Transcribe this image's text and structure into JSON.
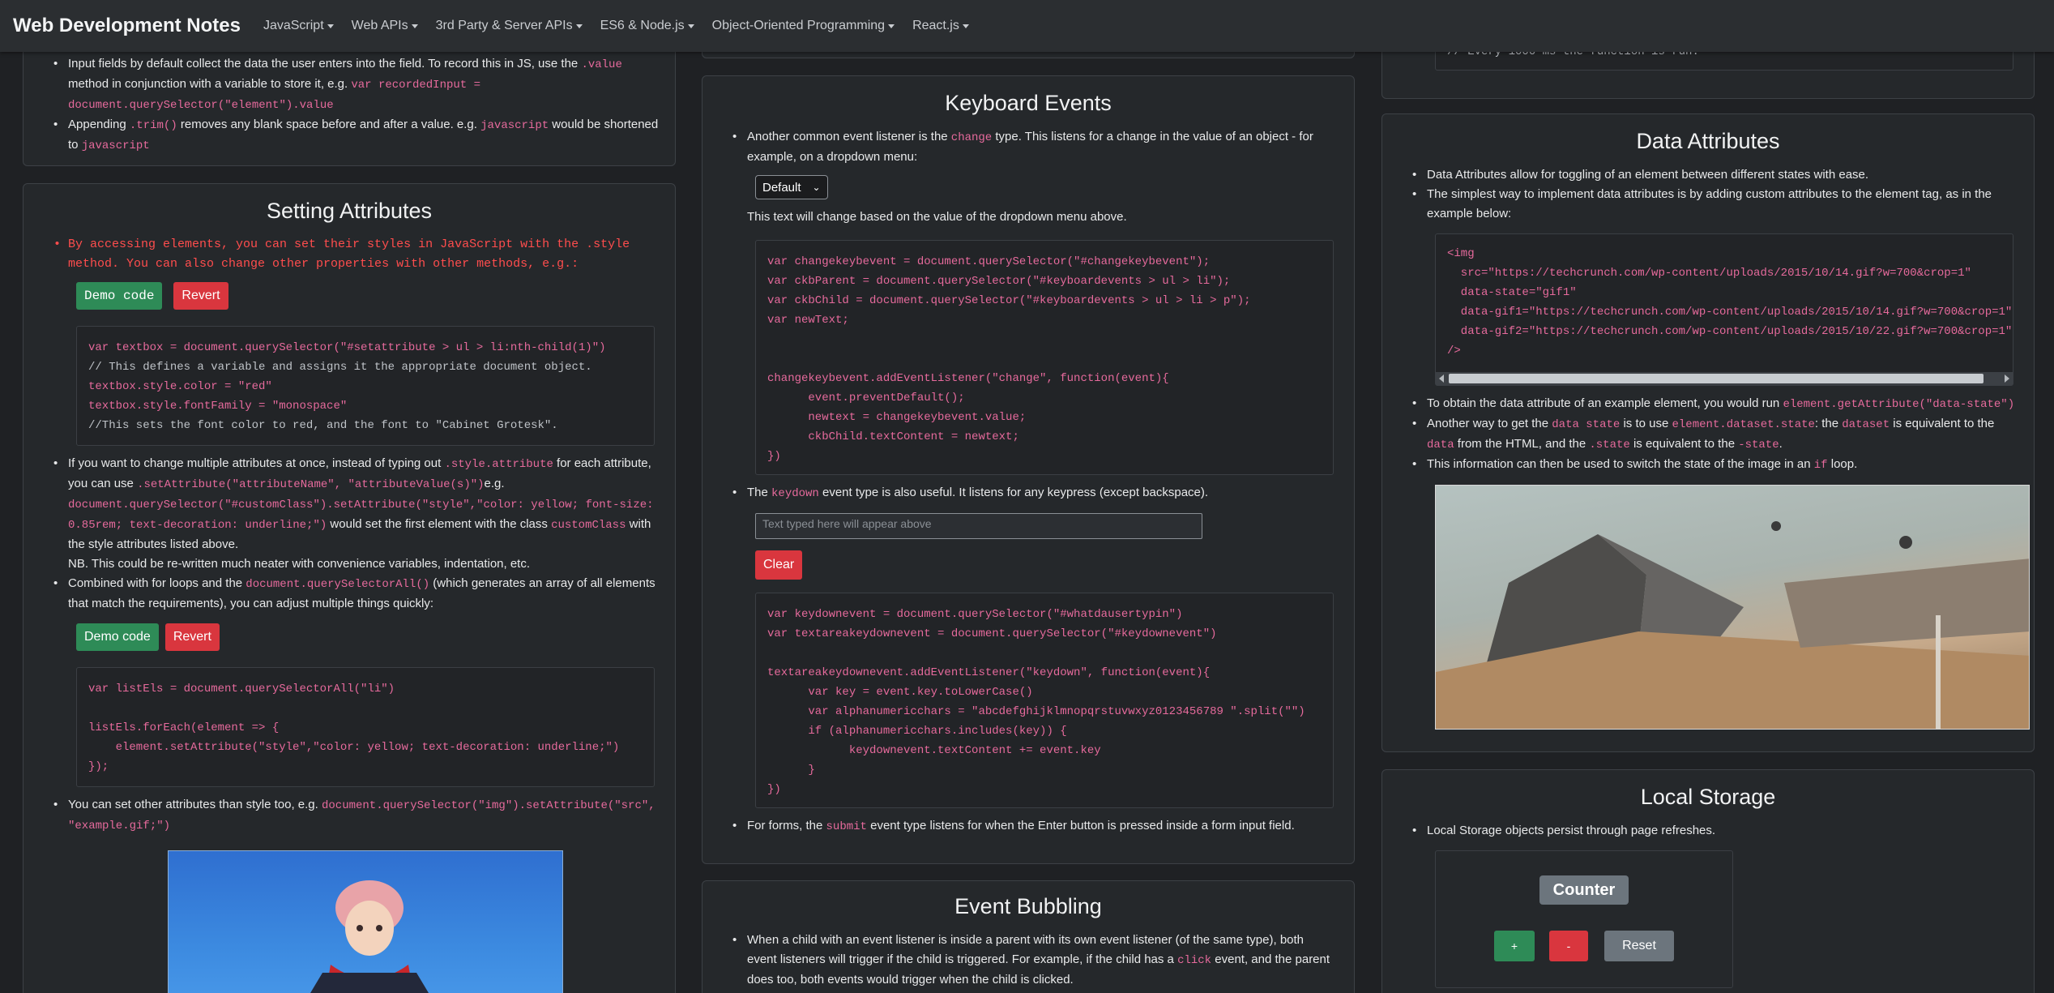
{
  "nav": {
    "brand": "Web Development Notes",
    "items": [
      "JavaScript",
      "Web APIs",
      "3rd Party & Server APIs",
      "ES6 & Node.js",
      "Object-Oriented Programming",
      "React.js"
    ]
  },
  "col1_top": {
    "li1_a": "Input fields by default collect the data the user enters into the field. To record this in JS, use the ",
    "li1_code1": ".value",
    "li1_b": "method in conjunction with a variable to store it, e.g. ",
    "li1_code2": "var recordedInput =",
    "li1_code3": "document.querySelector(\"element\").value",
    "li2_a": "Appending ",
    "li2_code1": ".trim()",
    "li2_b": " removes any blank space before and after a value. e.g. ",
    "li2_code2": "javascript",
    "li2_c": " would be shortened",
    "li2_d": "to ",
    "li2_code3": "javascript"
  },
  "setting_attributes": {
    "title": "Setting Attributes",
    "red_line1": "By accessing elements, you can set their styles in JavaScript with the .style",
    "red_line2": "method. You can also change other properties with other methods, e.g.:",
    "demo_button": "Demo code",
    "revert_button": "Revert",
    "code1": [
      "var textbox = document.querySelector(\"#setattribute > ul > li:nth-child(1)\")",
      "// This defines a variable and assigns it the appropriate document object.",
      "textbox.style.color = \"red\"",
      "textbox.style.fontFamily = \"monospace\"",
      "//This sets the font color to red, and the font to \"Cabinet Grotesk\"."
    ],
    "li2_a": "If you want to change multiple attributes at once, instead of typing out ",
    "li2_code1": ".style.attribute",
    "li2_b": " for each attribute,",
    "li2_c": "you can use ",
    "li2_code2": ".setAttribute(\"attributeName\", \"attributeValue(s)\")",
    "li2_d": "e.g.",
    "li2_code3": "document.querySelector(\"#customClass\").setAttribute(\"style\",\"color: yellow; font-size:",
    "li2_code4": "0.85rem; text-decoration: underline;\")",
    "li2_e": " would set the first element with the class ",
    "li2_code5": "customClass",
    "li2_f": " with",
    "li2_g": "the style attributes listed above.",
    "li2_nb": "NB. This could be re-written much neater with convenience variables, indentation, etc.",
    "li3_a": "Combined with for loops and the ",
    "li3_code": "document.querySelectorAll()",
    "li3_b": " (which generates an array of all elements",
    "li3_c": "that match the requirements), you can adjust multiple things quickly:",
    "demo_button2": "Demo code",
    "revert_button2": "Revert",
    "code2": [
      "var listEls = document.querySelectorAll(\"li\")",
      "",
      "listEls.forEach(element => {",
      "    element.setAttribute(\"style\",\"color: yellow; text-decoration: underline;\")",
      "});"
    ],
    "li4_a": "You can set other attributes than style too, e.g. ",
    "li4_code1": "document.querySelector(\"img\").setAttribute(\"src\",",
    "li4_code2": "\"example.gif;\")"
  },
  "keyboard_events": {
    "title": "Keyboard Events",
    "li1_a": "Another common event listener is the ",
    "li1_code": "change",
    "li1_b": " type. This listens for a change in the value of an object - for",
    "li1_c": "example, on a dropdown menu:",
    "select_value": "Default",
    "change_text": "This text will change based on the value of the dropdown menu above.",
    "code1": [
      "var changekeybevent = document.querySelector(\"#changekeybevent\");",
      "var ckbParent = document.querySelector(\"#keyboardevents > ul > li\");",
      "var ckbChild = document.querySelector(\"#keyboardevents > ul > li > p\");",
      "var newText;",
      "",
      "",
      "changekeybevent.addEventListener(\"change\", function(event){",
      "      event.preventDefault();",
      "      newtext = changekeybevent.value;",
      "      ckbChild.textContent = newtext;",
      "})"
    ],
    "li2_a": "The ",
    "li2_code": "keydown",
    "li2_b": " event type is also useful. It listens for any keypress (except backspace).",
    "textarea_placeholder": "Text typed here will appear above",
    "clear_button": "Clear",
    "code2": [
      "var keydownevent = document.querySelector(\"#whatdausertypin\")",
      "var textareakeydownevent = document.querySelector(\"#keydownevent\")",
      "",
      "textareakeydownevent.addEventListener(\"keydown\", function(event){",
      "      var key = event.key.toLowerCase()",
      "      var alphanumericchars = \"abcdefghijklmnopqrstuvwxyz0123456789 \".split(\"\")",
      "      if (alphanumericchars.includes(key)) {",
      "            keydownevent.textContent += event.key",
      "      }",
      "})"
    ],
    "li3_a": "For forms, the ",
    "li3_code": "submit",
    "li3_b": " event type listens for when the Enter button is pressed inside a form input field."
  },
  "event_bubbling": {
    "title": "Event Bubbling",
    "li1_a": "When a child with an event listener is inside a parent with its own event listener (of the same type), both",
    "li1_b": "event listeners will trigger if the child is triggered. For example, if the child has a ",
    "li1_code": "click",
    "li1_c": " event, and the parent",
    "li1_d": "does too, both events would trigger when the child is clicked."
  },
  "col3_top": {
    "code_comment": "// Every 1000 ms the function is run."
  },
  "data_attributes": {
    "title": "Data Attributes",
    "li1": "Data Attributes allow for toggling of an element between different states with ease.",
    "li2_a": "The simplest way to implement data attributes is by adding custom attributes to the element tag, as in the",
    "li2_b": "example below:",
    "code": [
      "<img",
      "  src=\"https://techcrunch.com/wp-content/uploads/2015/10/14.gif?w=700&crop=1\"",
      "  data-state=\"gif1\"",
      "  data-gif1=\"https://techcrunch.com/wp-content/uploads/2015/10/14.gif?w=700&crop=1\"",
      "  data-gif2=\"https://techcrunch.com/wp-content/uploads/2015/10/22.gif?w=700&crop=1\"",
      "/>"
    ],
    "li3_a": "To obtain the data attribute of an example element, you would run ",
    "li3_code": "element.getAttribute(\"data-state\")",
    "li4_a": "Another way to get the ",
    "li4_code1": "data state",
    "li4_b": " is to use ",
    "li4_code2": "element.dataset.state",
    "li4_c": ": the ",
    "li4_code3": "dataset",
    "li4_d": " is equivalent to the",
    "li4_code4": "data",
    "li4_e": " from the HTML, and the ",
    "li4_code5": ".state",
    "li4_f": " is equivalent to the ",
    "li4_code6": "-state",
    "li4_g": ".",
    "li5_a": "This information can then be used to switch the state of the image in an ",
    "li5_code": "if",
    "li5_b": " loop."
  },
  "local_storage": {
    "title": "Local Storage",
    "li1": "Local Storage objects persist through page refreshes.",
    "counter_label": "Counter",
    "plus": "+",
    "minus": "-",
    "reset": "Reset"
  }
}
